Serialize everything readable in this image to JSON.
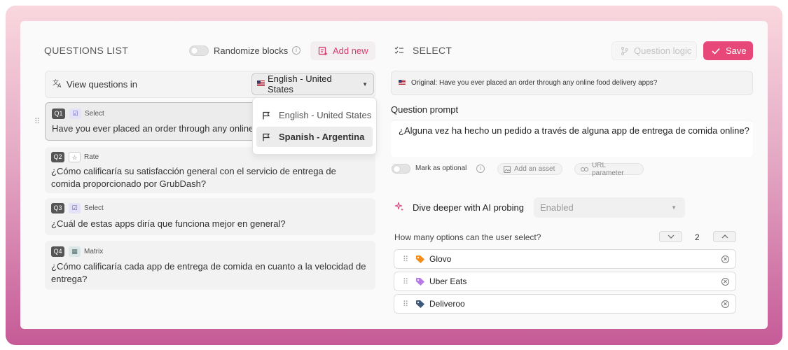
{
  "questions_list": {
    "title": "QUESTIONS LIST",
    "randomize_label": "Randomize blocks",
    "add_new_label": "Add new",
    "view_label": "View questions in",
    "selected_language": "English - United States",
    "language_options": [
      "English - United States",
      "Spanish - Argentina"
    ],
    "questions": [
      {
        "num": "Q1",
        "type": "Select",
        "text": "Have you ever placed an order through any online food delivery apps?"
      },
      {
        "num": "Q2",
        "type": "Rate",
        "text": "¿Cómo calificaría su satisfacción general con el servicio de entrega de comida proporcionado por GrubDash?"
      },
      {
        "num": "Q3",
        "type": "Select",
        "text": "¿Cuál de estas apps diría que funciona mejor en general?"
      },
      {
        "num": "Q4",
        "type": "Matrix",
        "text": "¿Cómo calificaría cada app de entrega de comida en cuanto a la velocidad de entrega?"
      }
    ]
  },
  "editor": {
    "title": "SELECT",
    "question_logic_label": "Question logic",
    "save_label": "Save",
    "original": "Original: Have you ever placed an order through any online food delivery apps?",
    "prompt_label": "Question prompt",
    "prompt_text": "¿Alguna vez ha hecho un pedido a través de alguna app de entrega de comida online?",
    "optional_label": "Mark as optional",
    "asset_label": "Add an asset",
    "url_label": "URL parameter",
    "ai_label": "Dive deeper with AI probing",
    "ai_value": "Enabled",
    "howmany_label": "How many options can the user select?",
    "howmany_value": "2",
    "options": [
      {
        "label": "Glovo",
        "color": "#f28c1a"
      },
      {
        "label": "Uber Eats",
        "color": "#b57be3"
      },
      {
        "label": "Deliveroo",
        "color": "#3f5a7a"
      }
    ]
  },
  "colors": {
    "accent": "#e8477a",
    "frame_top": "#f9d7de",
    "frame_bottom": "#c65a97"
  }
}
